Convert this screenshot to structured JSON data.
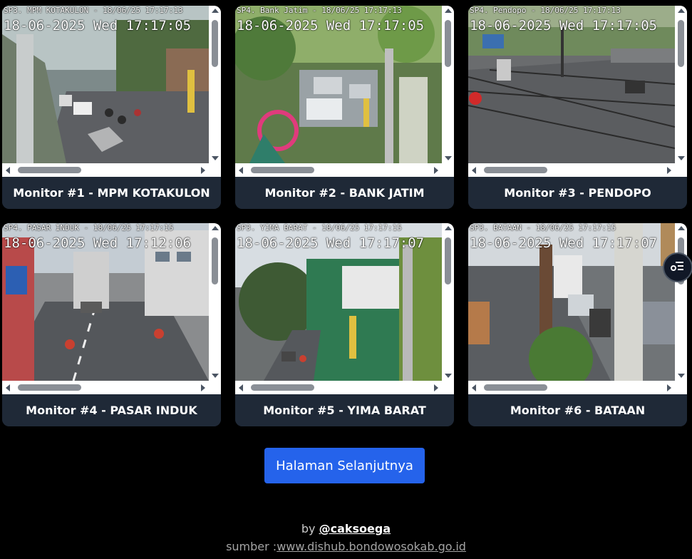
{
  "monitors": [
    {
      "osd": "SP3. MPM KOTAKULON - 18/06/25 17:17:13",
      "osd_time": "18-06-2025 Wed 17:17:05",
      "caption": "Monitor #1 - MPM KOTAKULON",
      "scene": "street-left"
    },
    {
      "osd": "SP4. Bank Jatim - 18/06/25 17:17:13",
      "osd_time": "18-06-2025 Wed 17:17:05",
      "caption": "Monitor #2 - BANK JATIM",
      "scene": "park"
    },
    {
      "osd": "SP4. Pendopo - 18/06/25 17:17:13",
      "osd_time": "18-06-2025 Wed 17:17:05",
      "caption": "Monitor #3 - PENDOPO",
      "scene": "intersection"
    },
    {
      "osd": "SP4. PASAR INDUK - 18/06/25 17:17:15",
      "osd_time": "18-06-2025 Wed 17:12:06",
      "caption": "Monitor #4 - PASAR INDUK",
      "scene": "avenue"
    },
    {
      "osd": "SP3. YIMA BARAT - 18/06/25 17:17:15",
      "osd_time": "18-06-2025 Wed 17:17:07",
      "caption": "Monitor #5 - YIMA BARAT",
      "scene": "building"
    },
    {
      "osd": "SP3. BATAAN - 18/06/25 17:17:15",
      "osd_time": "18-06-2025 Wed 17:17:07",
      "caption": "Monitor #6 - BATAAN",
      "scene": "truck-road"
    }
  ],
  "next_page_label": "Halaman Selanjutnya",
  "footer": {
    "by_prefix": "by",
    "author": "@caksoega",
    "source_prefix": "sumber :",
    "source_link": "www.dishub.bondowosokab.go.id"
  },
  "colors": {
    "background": "#000000",
    "card_caption_bg": "#1f2937",
    "button": "#2563eb"
  },
  "icons": {
    "floating_button": "filter-list-icon"
  }
}
